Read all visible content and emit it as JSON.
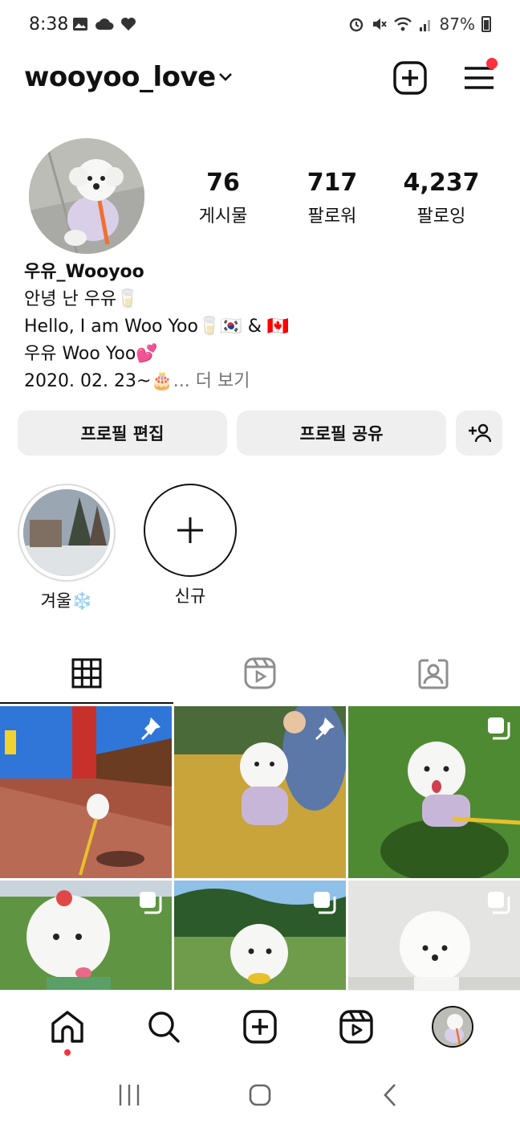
{
  "status": {
    "time": "8:38",
    "battery": "87%"
  },
  "header": {
    "username": "wooyoo_love"
  },
  "stats": [
    {
      "value": "76",
      "label": "게시물"
    },
    {
      "value": "717",
      "label": "팔로워"
    },
    {
      "value": "4,237",
      "label": "팔로잉"
    }
  ],
  "bio": {
    "name": "우유_Wooyoo",
    "line1": "안녕 난 우유🥛",
    "line2": "Hello, I am Woo Yoo🥛🇰🇷  & 🇨🇦",
    "line3": "우유 Woo Yoo💕",
    "line4": "2020. 02. 23~🎂",
    "more": "... 더 보기"
  },
  "buttons": {
    "edit": "프로필 편집",
    "share": "프로필 공유"
  },
  "highlights": [
    {
      "label": "겨울❄️"
    },
    {
      "label": "신규"
    }
  ],
  "colors": {
    "notification": "#ff3040",
    "button_bg": "#efefef"
  }
}
